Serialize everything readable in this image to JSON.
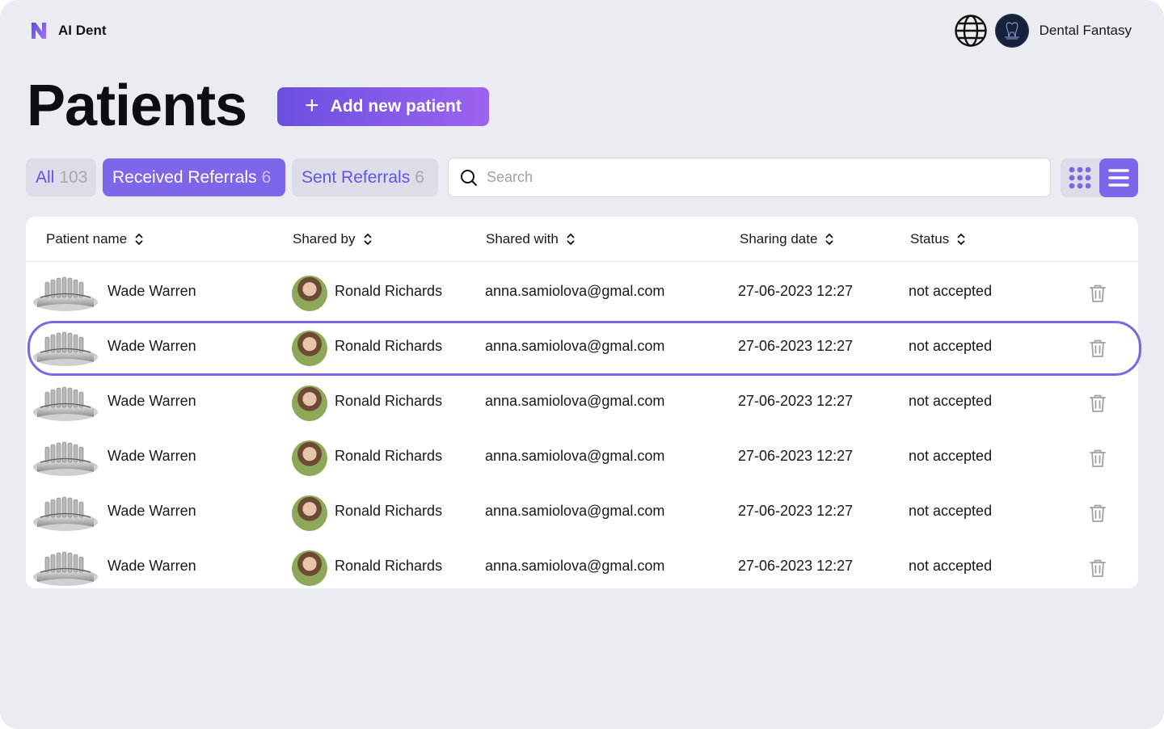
{
  "app": {
    "brand": "AI Dent",
    "brand_logo": "n-logo-icon",
    "accent": "#7e65ea"
  },
  "account": {
    "clinic_name": "Dental Fantasy",
    "clinic_logo": "western-logo"
  },
  "page": {
    "title": "Patients",
    "add_button": "Add new patient"
  },
  "tabs": [
    {
      "label": "All",
      "count": "103",
      "active": false
    },
    {
      "label": "Received Referrals",
      "count": "6",
      "active": true
    },
    {
      "label": "Sent Referrals",
      "count": "6",
      "active": false
    }
  ],
  "search": {
    "placeholder": "Search",
    "value": ""
  },
  "view_toggle": {
    "options": [
      "grid-icon",
      "list-icon"
    ],
    "active": "list-icon"
  },
  "table": {
    "columns": [
      "Patient name",
      "Shared by",
      "Shared with",
      "Sharing date",
      "Status"
    ],
    "rows": [
      {
        "patient": "Wade Warren",
        "shared_by": "Ronald Richards",
        "shared_with": "anna.samiolova@gmal.com",
        "date": "27-06-2023 12:27",
        "status": "not accepted"
      },
      {
        "patient": "Wade Warren",
        "shared_by": "Ronald Richards",
        "shared_with": "anna.samiolova@gmal.com",
        "date": "27-06-2023 12:27",
        "status": "not accepted"
      },
      {
        "patient": "Wade Warren",
        "shared_by": "Ronald Richards",
        "shared_with": "anna.samiolova@gmal.com",
        "date": "27-06-2023 12:27",
        "status": "not accepted"
      },
      {
        "patient": "Wade Warren",
        "shared_by": "Ronald Richards",
        "shared_with": "anna.samiolova@gmal.com",
        "date": "27-06-2023 12:27",
        "status": "not accepted"
      },
      {
        "patient": "Wade Warren",
        "shared_by": "Ronald Richards",
        "shared_with": "anna.samiolova@gmal.com",
        "date": "27-06-2023 12:27",
        "status": "not accepted"
      },
      {
        "patient": "Wade Warren",
        "shared_by": "Ronald Richards",
        "shared_with": "anna.samiolova@gmal.com",
        "date": "27-06-2023 12:27",
        "status": "not accepted"
      }
    ],
    "highlighted_row": 1
  }
}
